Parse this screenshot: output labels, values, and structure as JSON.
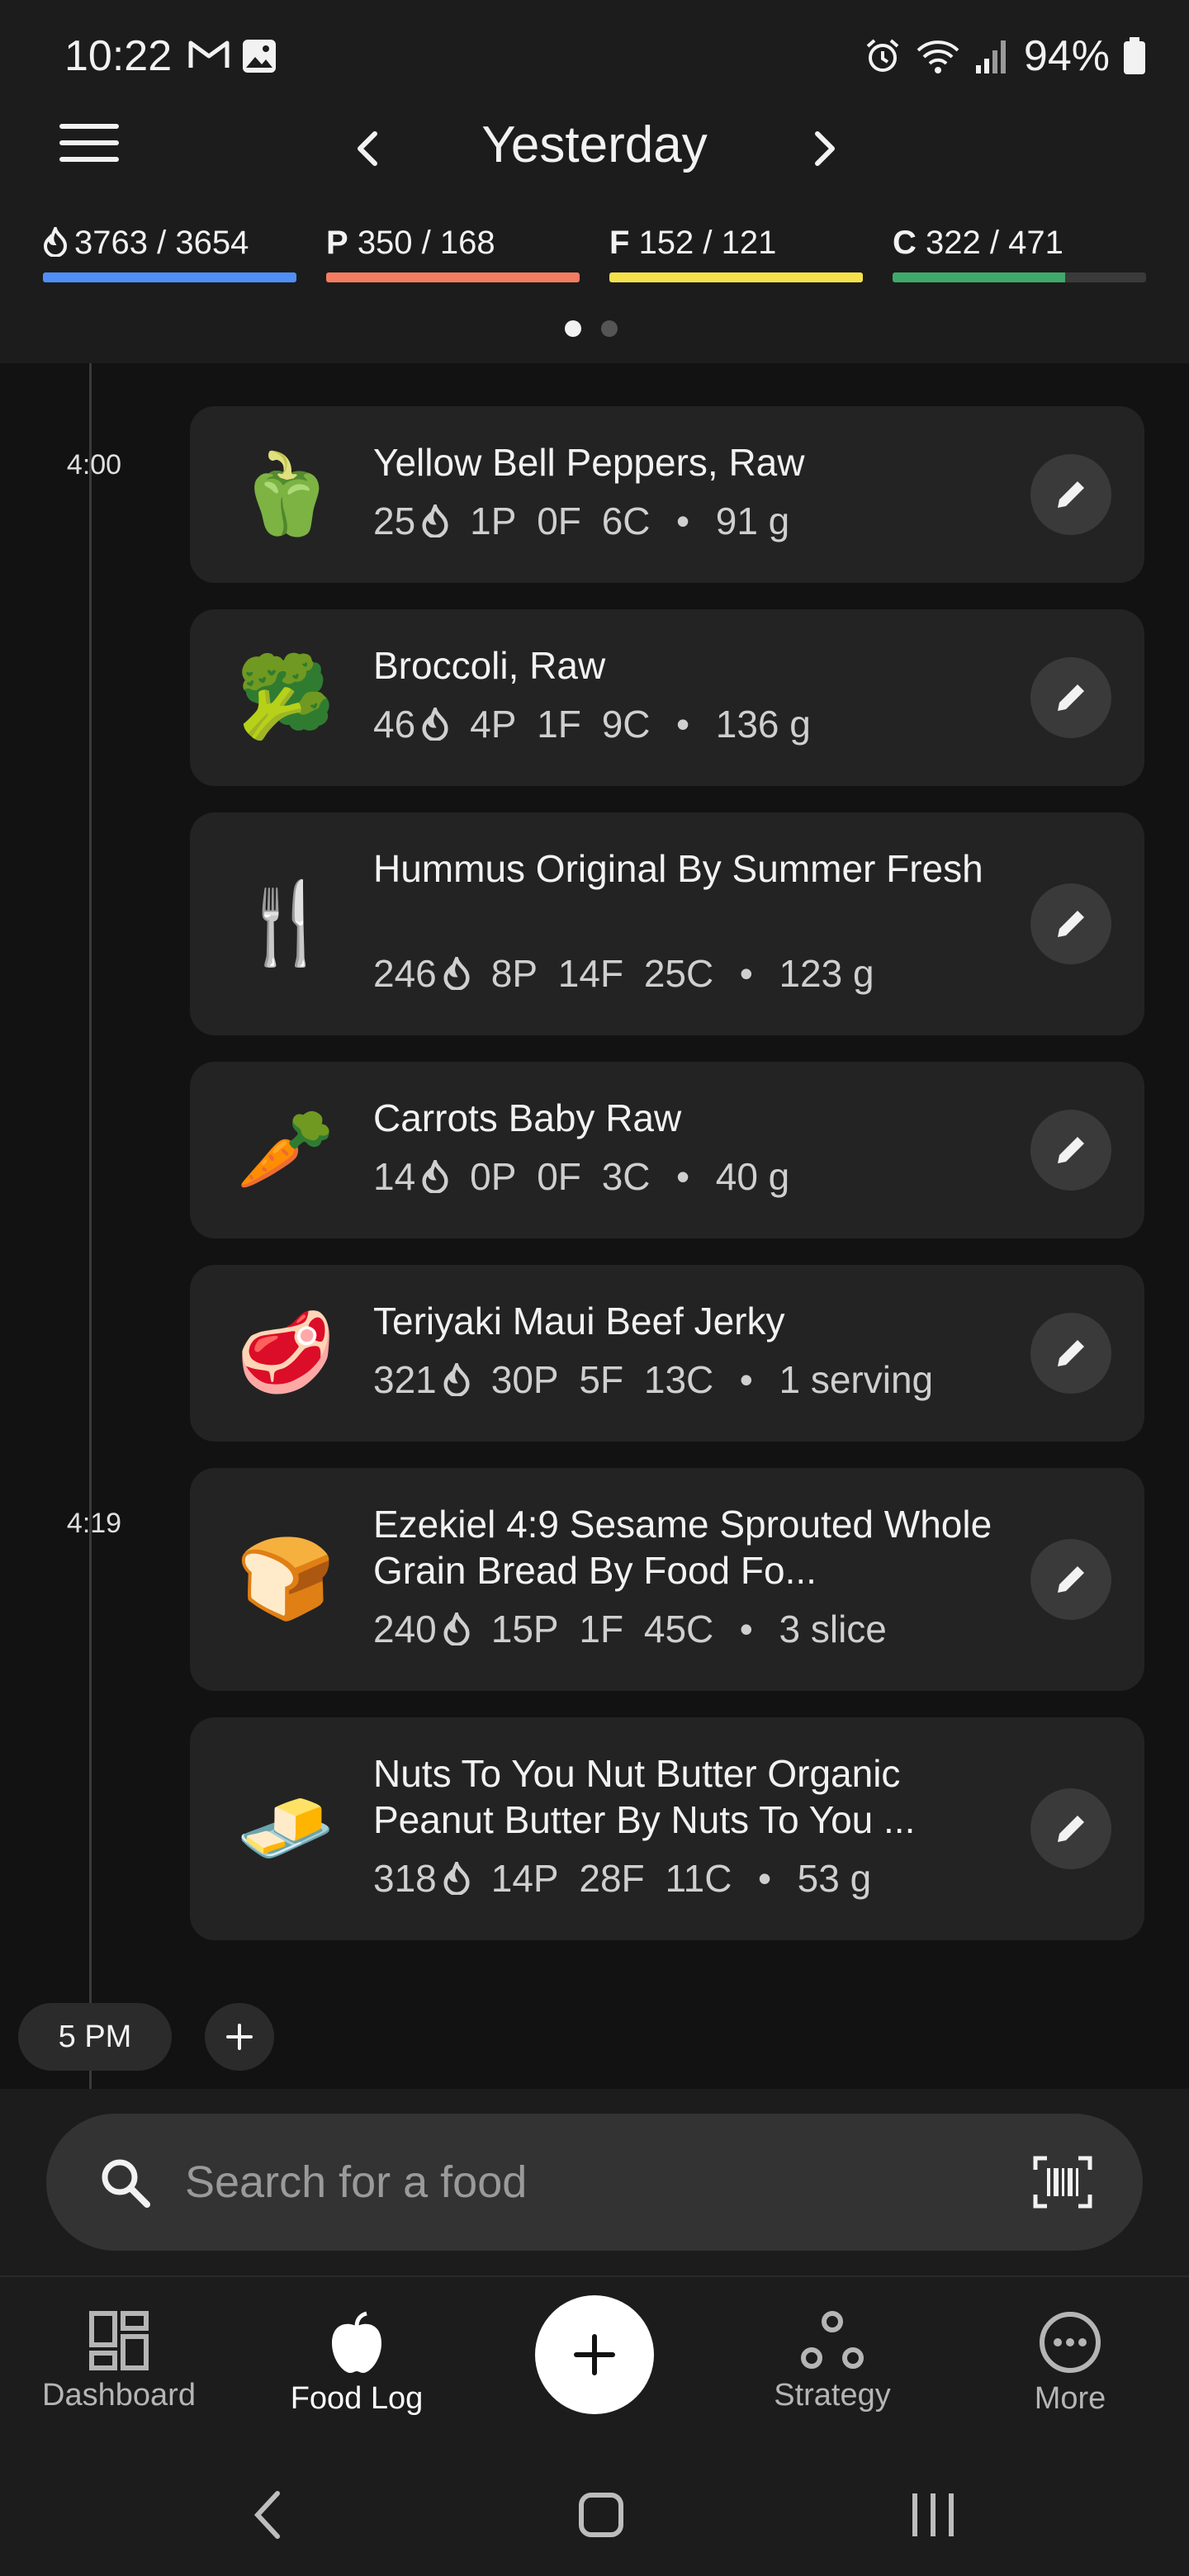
{
  "status_bar": {
    "time": "10:22",
    "battery": "94%"
  },
  "header": {
    "title": "Yesterday",
    "macros": [
      {
        "icon": "flame",
        "label": "",
        "value": "3763 / 3654",
        "color": "#4f8ff7",
        "progress": 1.0
      },
      {
        "icon": "",
        "label": "P",
        "value": "350 / 168",
        "color": "#f47c61",
        "progress": 1.0
      },
      {
        "icon": "",
        "label": "F",
        "value": "152 / 121",
        "color": "#f5e14b",
        "progress": 1.0
      },
      {
        "icon": "",
        "label": "C",
        "value": "322 / 471",
        "color": "#3fa96b",
        "progress": 0.68
      }
    ]
  },
  "timeline": {
    "times": [
      "4:00",
      "4:19"
    ],
    "hour_chip": "5 PM"
  },
  "entries": [
    {
      "emoji": "🫑",
      "name": "Yellow Bell Peppers, Raw",
      "cal": "25",
      "p": "1P",
      "f": "0F",
      "c": "6C",
      "amount": "91 g"
    },
    {
      "emoji": "🥦",
      "name": "Broccoli, Raw",
      "cal": "46",
      "p": "4P",
      "f": "1F",
      "c": "9C",
      "amount": "136 g"
    },
    {
      "emoji": "🍴",
      "name": "Hummus Original By Summer Fresh",
      "cal": "246",
      "p": "8P",
      "f": "14F",
      "c": "25C",
      "amount": "123 g"
    },
    {
      "emoji": "🥕",
      "name": "Carrots Baby Raw",
      "cal": "14",
      "p": "0P",
      "f": "0F",
      "c": "3C",
      "amount": "40 g"
    },
    {
      "emoji": "🥩",
      "name": "Teriyaki Maui Beef Jerky",
      "cal": "321",
      "p": "30P",
      "f": "5F",
      "c": "13C",
      "amount": "1 serving"
    },
    {
      "emoji": "🍞",
      "name": "Ezekiel 4:9 Sesame Sprouted Whole Grain Bread By Food Fo...",
      "cal": "240",
      "p": "15P",
      "f": "1F",
      "c": "45C",
      "amount": "3 slice"
    },
    {
      "emoji": "🧈",
      "name": "Nuts To You Nut Butter Organic Peanut Butter By Nuts To You ...",
      "cal": "318",
      "p": "14P",
      "f": "28F",
      "c": "11C",
      "amount": "53 g"
    }
  ],
  "search": {
    "placeholder": "Search for a food"
  },
  "bottom_nav": [
    {
      "label": "Dashboard",
      "icon": "dashboard-icon"
    },
    {
      "label": "Food Log",
      "icon": "apple-icon"
    },
    {
      "label": "Strategy",
      "icon": "strategy-icon"
    },
    {
      "label": "More",
      "icon": "more-icon"
    }
  ]
}
